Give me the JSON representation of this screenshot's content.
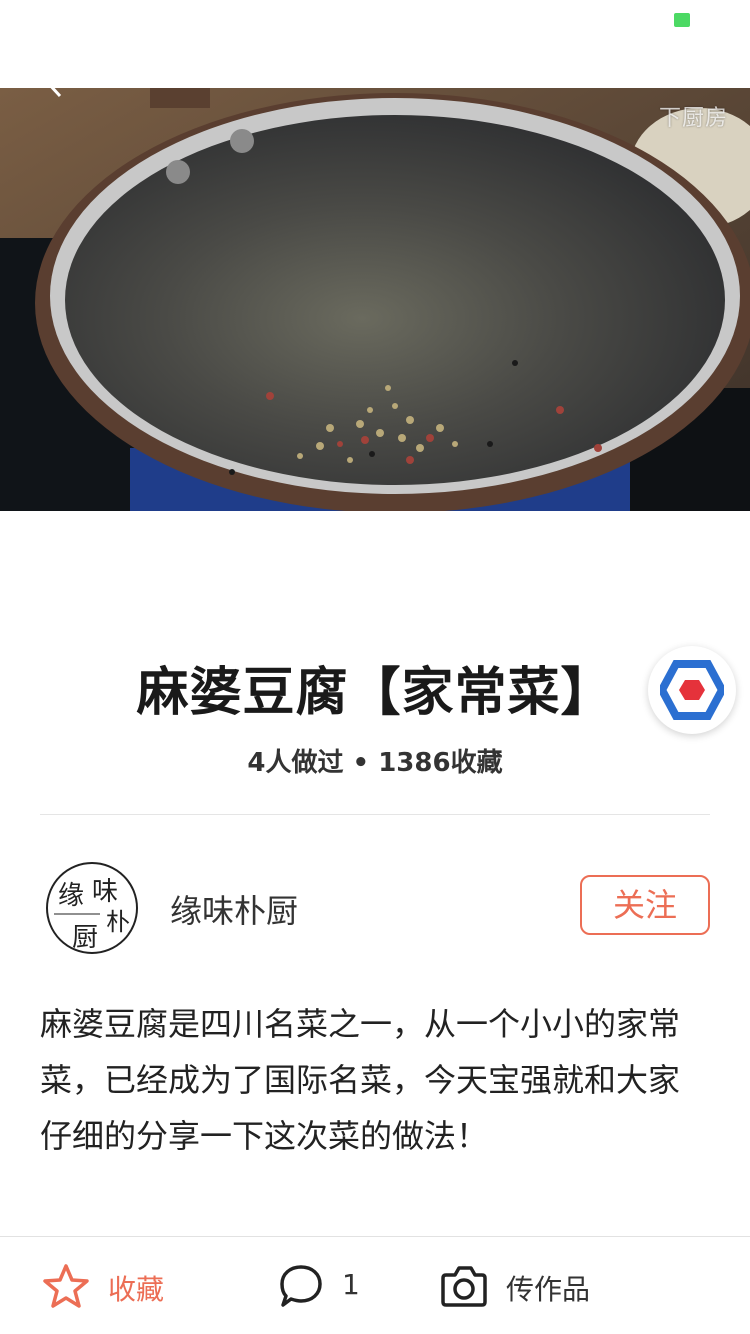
{
  "status_bar": {
    "indicator_color": "#4cd964"
  },
  "hero": {
    "watermark": "下厨房",
    "back_icon": "chevron-left-icon"
  },
  "recipe": {
    "title": "麻婆豆腐【家常菜】",
    "stats": "4人做过 • 1386收藏"
  },
  "float_badge": {
    "icon": "hexagon-logo-icon",
    "colors": [
      "#2b6fd1",
      "#e5323b"
    ]
  },
  "author": {
    "name": "缘味朴厨",
    "avatar_text": [
      "缘",
      "味",
      "朴",
      "厨"
    ],
    "follow_label": "关注"
  },
  "description": "麻婆豆腐是四川名菜之一，从一个小小的家常菜，已经成为了国际名菜，今天宝强就和大家仔细的分享一下这次菜的做法！",
  "bottom_bar": {
    "favorite": {
      "icon": "star-icon",
      "label": "收藏"
    },
    "comment": {
      "icon": "comment-bubble-icon",
      "count": "1"
    },
    "upload": {
      "icon": "camera-icon",
      "label": "传作品"
    }
  },
  "colors": {
    "accent": "#ec6e55",
    "divider": "#e5e5e5"
  }
}
